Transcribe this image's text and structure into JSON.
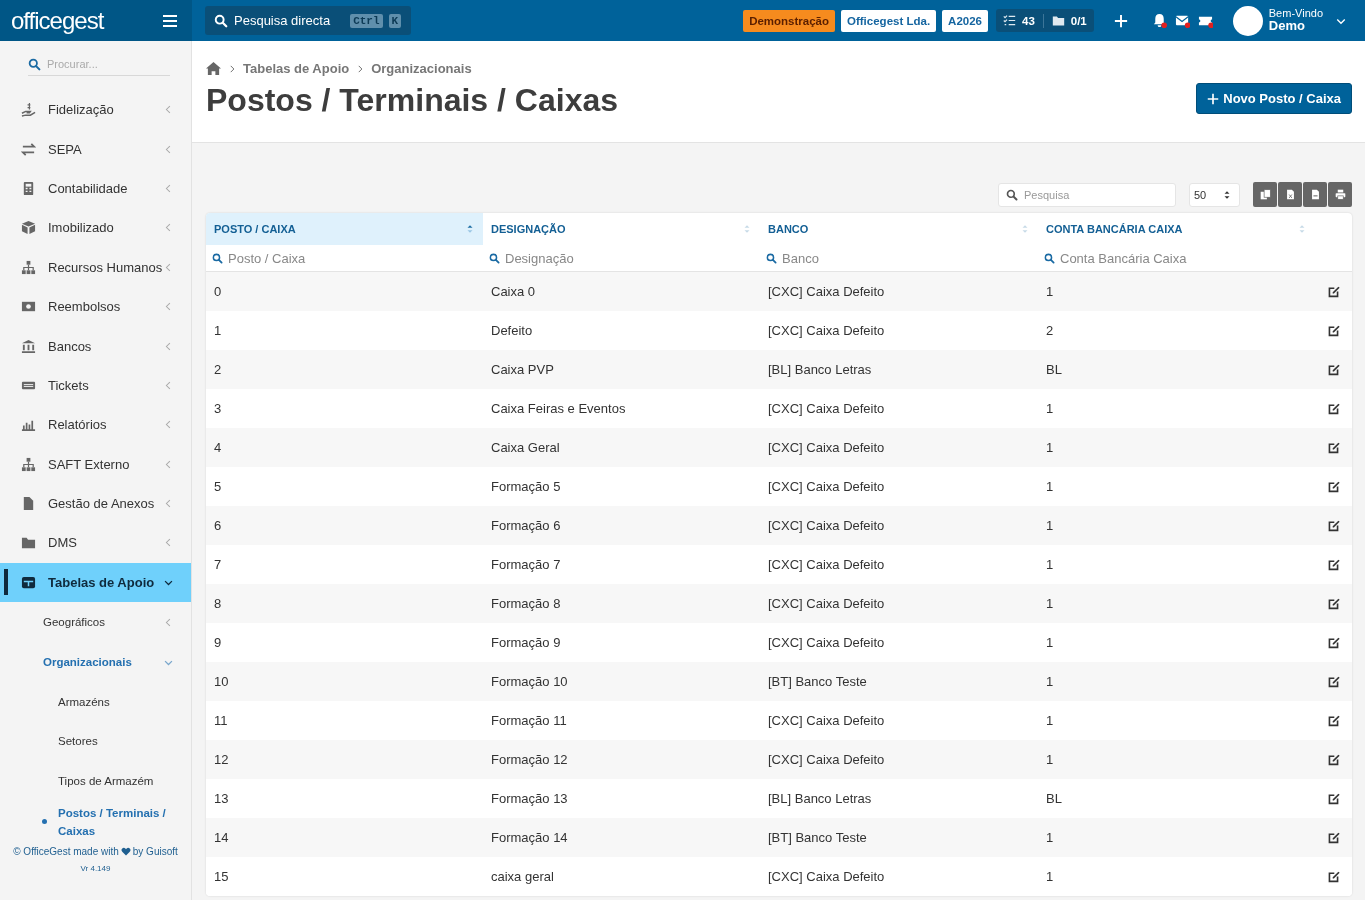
{
  "topbar": {
    "logo": "officegest",
    "search": {
      "placeholder": "Pesquisa directa",
      "keys": [
        "Ctrl",
        "K"
      ]
    },
    "badges": [
      {
        "text": "Demonstração",
        "kind": "warning"
      },
      {
        "text": "Officegest Lda.",
        "kind": "light"
      },
      {
        "text": "A2026",
        "kind": "light"
      }
    ],
    "counters": [
      "43",
      "0/1"
    ],
    "user": {
      "greeting": "Bem-Vindo",
      "name": "Demo"
    }
  },
  "sidebar": {
    "search": {
      "placeholder": "Procurar..."
    },
    "items": [
      {
        "label": "Fidelização",
        "expanded": false,
        "selected": false
      },
      {
        "label": "SEPA",
        "expanded": false,
        "selected": false
      },
      {
        "label": "Contabilidade",
        "expanded": false,
        "selected": false
      },
      {
        "label": "Imobilizado",
        "expanded": false,
        "selected": false
      },
      {
        "label": "Recursos Humanos",
        "expanded": false,
        "selected": false
      },
      {
        "label": "Reembolsos",
        "expanded": false,
        "selected": false
      },
      {
        "label": "Bancos",
        "expanded": false,
        "selected": false
      },
      {
        "label": "Tickets",
        "expanded": false,
        "selected": false
      },
      {
        "label": "Relatórios",
        "expanded": false,
        "selected": false
      },
      {
        "label": "SAFT Externo",
        "expanded": false,
        "selected": false
      },
      {
        "label": "Gestão de Anexos",
        "expanded": false,
        "selected": false
      },
      {
        "label": "DMS",
        "expanded": false,
        "selected": false
      },
      {
        "label": "Tabelas de Apoio",
        "expanded": true,
        "selected": true,
        "children": [
          {
            "label": "Geográficos",
            "expanded": false,
            "selected": false
          },
          {
            "label": "Organizacionais",
            "expanded": true,
            "selected": true,
            "children": [
              {
                "label": "Armazéns",
                "selected": false
              },
              {
                "label": "Setores",
                "selected": false
              },
              {
                "label": "Tipos de Armazém",
                "selected": false
              },
              {
                "label": "Postos / Terminais / Caixas",
                "selected": true
              }
            ]
          }
        ]
      }
    ],
    "footer": {
      "before": "© OfficeGest made with",
      "after": "by Guisoft",
      "version": "Vr 4.149"
    }
  },
  "breadcrumb": [
    "Tabelas de Apoio",
    "Organizacionais"
  ],
  "title": "Postos / Terminais / Caixas",
  "new_button": "Novo Posto / Caixa",
  "toolbar": {
    "search": {
      "placeholder": "Pesquisa"
    },
    "page_size": "50"
  },
  "table": {
    "columns": [
      {
        "label": "POSTO / CAIXA",
        "sorted": true,
        "filter_placeholder": "Posto / Caixa"
      },
      {
        "label": "DESIGNAÇÃO",
        "sorted": false,
        "filter_placeholder": "Designação"
      },
      {
        "label": "BANCO",
        "sorted": false,
        "filter_placeholder": "Banco"
      },
      {
        "label": "CONTA BANCÁRIA CAIXA",
        "sorted": false,
        "filter_placeholder": "Conta Bancária Caixa"
      }
    ],
    "rows": [
      [
        "0",
        "Caixa 0",
        "[CXC] Caixa Defeito",
        "1"
      ],
      [
        "1",
        "Defeito",
        "[CXC] Caixa Defeito",
        "2"
      ],
      [
        "2",
        "Caixa PVP",
        "[BL] Banco Letras",
        "BL"
      ],
      [
        "3",
        "Caixa Feiras e Eventos",
        "[CXC] Caixa Defeito",
        "1"
      ],
      [
        "4",
        "Caixa Geral",
        "[CXC] Caixa Defeito",
        "1"
      ],
      [
        "5",
        "Formação 5",
        "[CXC] Caixa Defeito",
        "1"
      ],
      [
        "6",
        "Formação 6",
        "[CXC] Caixa Defeito",
        "1"
      ],
      [
        "7",
        "Formação 7",
        "[CXC] Caixa Defeito",
        "1"
      ],
      [
        "8",
        "Formação 8",
        "[CXC] Caixa Defeito",
        "1"
      ],
      [
        "9",
        "Formação 9",
        "[CXC] Caixa Defeito",
        "1"
      ],
      [
        "10",
        "Formação 10",
        "[BT] Banco Teste",
        "1"
      ],
      [
        "11",
        "Formação 11",
        "[CXC] Caixa Defeito",
        "1"
      ],
      [
        "12",
        "Formação 12",
        "[CXC] Caixa Defeito",
        "1"
      ],
      [
        "13",
        "Formação 13",
        "[BL] Banco Letras",
        "BL"
      ],
      [
        "14",
        "Formação 14",
        "[BT] Banco Teste",
        "1"
      ],
      [
        "15",
        "caixa geral",
        "[CXC] Caixa Defeito",
        "1"
      ]
    ]
  }
}
